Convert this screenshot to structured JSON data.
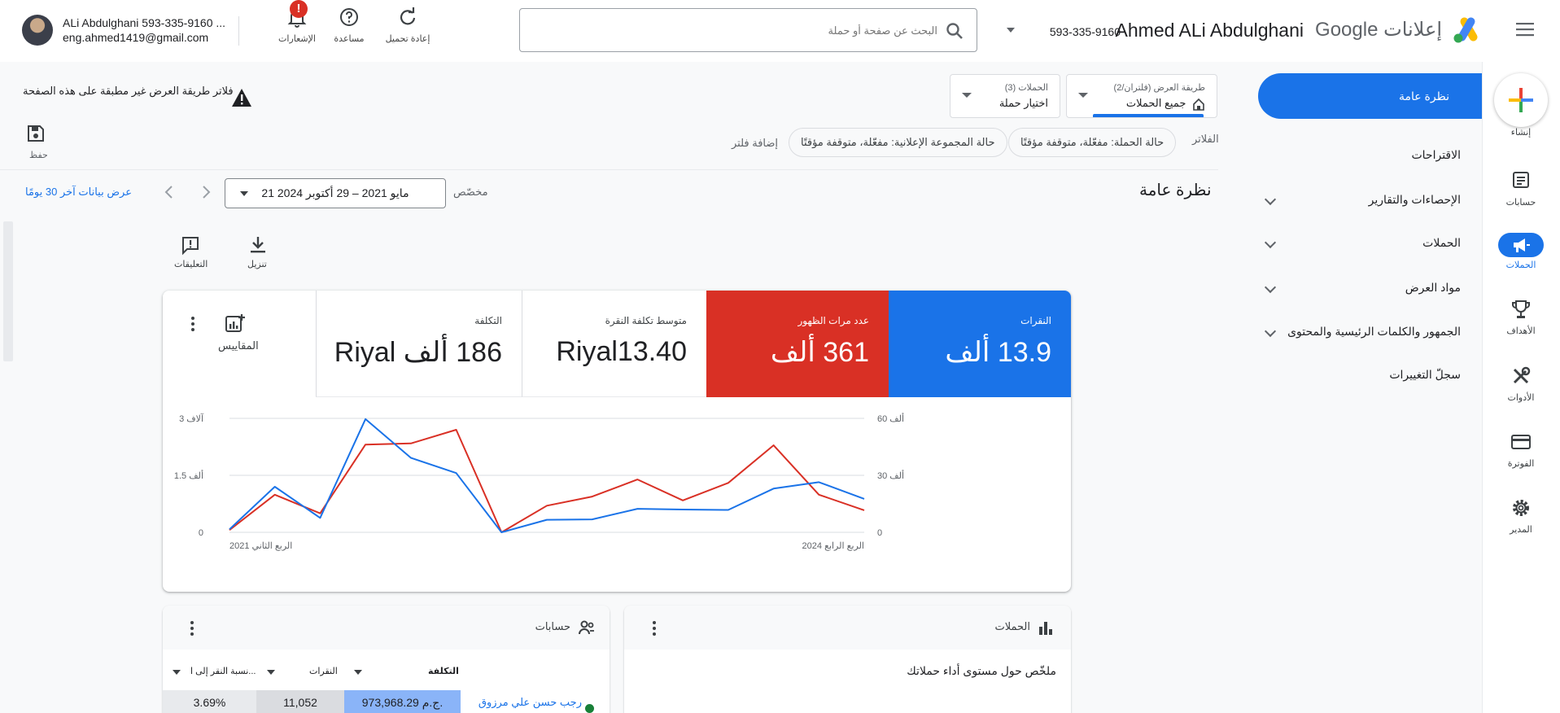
{
  "header": {
    "product_name": "إعلانات",
    "brand": "Google",
    "account_name": "Ahmed ALi Abdulghani",
    "account_id": "593-335-9160",
    "search_placeholder": "البحث عن صفحة أو حملة",
    "tools": {
      "refresh_label": "إعادة تحميل",
      "help_label": "مساعدة",
      "notifications_label": "الإشعارات",
      "notifications_badge": "!"
    },
    "user": {
      "name": "ALi Abdulghani 593-335-9160 ...",
      "email": "eng.ahmed1419@gmail.com"
    }
  },
  "rail": {
    "create": "إنشاء",
    "accounts": "حسابات",
    "campaigns": "الحملات",
    "goals": "الأهداف",
    "tools": "الأدوات",
    "billing": "الفوترة",
    "admin": "المدير"
  },
  "subnav": {
    "items": [
      {
        "label": "نظرة عامة",
        "active": true
      },
      {
        "label": "الاقتراحات"
      },
      {
        "label": "الإحصاءات والتقارير"
      },
      {
        "label": "الحملات"
      },
      {
        "label": "مواد العرض"
      },
      {
        "label": "الجمهور والكلمات الرئيسية والمحتوى"
      },
      {
        "label": "سجلّ التغييرات"
      }
    ]
  },
  "filters": {
    "view_label": "طريقة العرض (فلتران/2)",
    "view_value": "جميع الحملات",
    "campaigns_label": "الحملات (3)",
    "campaigns_value": "اختيار حملة",
    "warning": "فلاتر طريقة العرض غير مطبقة على هذه الصفحة",
    "save_label": "حفظ",
    "filters_label": "الفلاتر",
    "chips": [
      "حالة الحملة: مفعّلة، متوقفة مؤقتًا",
      "حالة المجموعة الإعلانية: مفعّلة، متوقفة مؤقتًا"
    ],
    "add_filter": "إضافة فلتر"
  },
  "page": {
    "title": "نظرة عامة",
    "date_mode": "مخصّص",
    "date_range": "21 مايو 2021 – 29 أكتوبر 2024",
    "show_last_30": "عرض بيانات آخر 30 يومًا",
    "download_label": "تنزيل",
    "comments_label": "التعليقات"
  },
  "metrics": {
    "items": [
      {
        "label": "النقرات",
        "value": "13.9 ألف",
        "color": "#1a73e8"
      },
      {
        "label": "عدد مرات الظهور",
        "value": "361 ألف",
        "color": "#d93025"
      },
      {
        "label": "متوسط تكلفة النقرة",
        "value": "Riyal13.40"
      },
      {
        "label": "التكلفة",
        "value": "186 ألف Riyal"
      }
    ],
    "more_label": "المقاييس"
  },
  "chart_data": {
    "type": "line",
    "x_labels": [
      "الربع الثاني 2021",
      "الربع الرابع 2024"
    ],
    "left_axis": {
      "ticks": [
        "0",
        "1.5 ألف",
        "3 آلاف"
      ],
      "ylim": [
        0,
        3000
      ]
    },
    "right_axis": {
      "ticks": [
        "0",
        "30 ألف",
        "60 ألف"
      ],
      "ylim": [
        0,
        60000
      ]
    },
    "grid": true,
    "series": [
      {
        "metric": "clicks",
        "color": "#1a73e8",
        "axis": "left",
        "values": [
          80,
          1200,
          380,
          2980,
          1960,
          1560,
          0,
          330,
          340,
          620,
          600,
          590,
          1150,
          1320,
          880
        ]
      },
      {
        "metric": "impressions",
        "color": "#d93025",
        "axis": "right",
        "values": [
          1200,
          19800,
          10000,
          46200,
          46800,
          54000,
          0,
          14000,
          18800,
          27800,
          16800,
          26000,
          45800,
          19800,
          11600
        ]
      }
    ]
  },
  "bottom": {
    "campaigns_title": "الحملات",
    "campaigns_summary": "ملخّص حول مستوى أداء حملاتك",
    "accounts_title": "حسابات",
    "table": {
      "columns": [
        "التكلفة",
        "النقرات",
        "نسبة النقر إلى ا..."
      ],
      "row": {
        "name": "رجب حسن علي مرزوق",
        "cost": "973,968.29 ج.م.",
        "clicks": "11,052",
        "ctr": "3.69%"
      }
    }
  }
}
